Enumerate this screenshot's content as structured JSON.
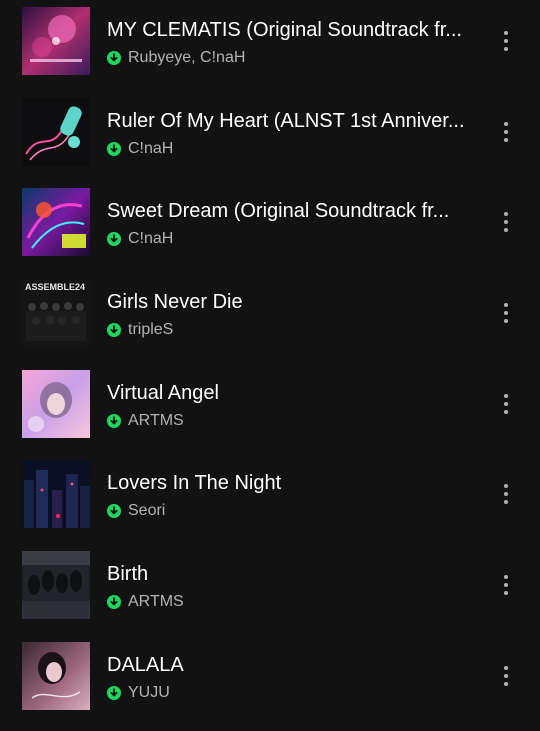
{
  "tracks": [
    {
      "title": "MY CLEMATIS (Original Soundtrack fr...",
      "artist": "Rubyeye, C!naH",
      "downloaded": true,
      "cover_icon": "clematis-album-art"
    },
    {
      "title": "Ruler Of My Heart (ALNST 1st Anniver...",
      "artist": "C!naH",
      "downloaded": true,
      "cover_icon": "ruler-of-my-heart-album-art"
    },
    {
      "title": "Sweet Dream (Original Soundtrack fr...",
      "artist": "C!naH",
      "downloaded": true,
      "cover_icon": "sweet-dream-album-art"
    },
    {
      "title": "Girls Never Die",
      "artist": "tripleS",
      "downloaded": true,
      "cover_icon": "assemble24-album-art",
      "cover_text": "ASSEMBLE24"
    },
    {
      "title": "Virtual Angel",
      "artist": "ARTMS",
      "downloaded": true,
      "cover_icon": "virtual-angel-album-art"
    },
    {
      "title": "Lovers In The Night",
      "artist": "Seori",
      "downloaded": true,
      "cover_icon": "lovers-in-the-night-album-art"
    },
    {
      "title": "Birth",
      "artist": "ARTMS",
      "downloaded": true,
      "cover_icon": "birth-album-art"
    },
    {
      "title": "DALALA",
      "artist": "YUJU",
      "downloaded": true,
      "cover_icon": "dalala-album-art"
    }
  ],
  "colors": {
    "background": "#121212",
    "title_text": "#ffffff",
    "secondary_text": "#b3b3b3",
    "download_accent": "#1ed760"
  }
}
